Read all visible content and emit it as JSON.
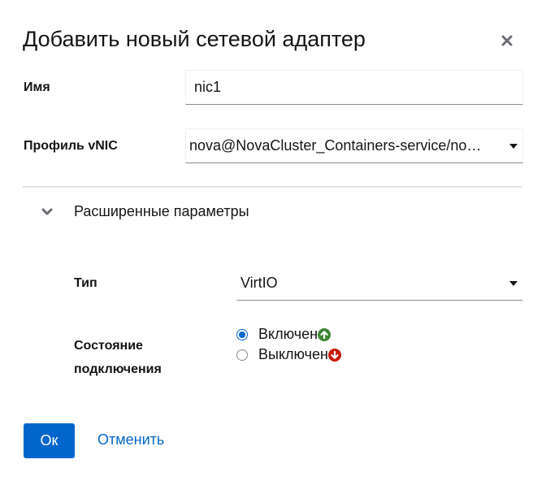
{
  "dialog": {
    "title": "Добавить новый сетевой адаптер",
    "close_icon": "close-icon"
  },
  "form": {
    "name": {
      "label": "Имя",
      "value": "nic1"
    },
    "vnic_profile": {
      "label": "Профиль vNIC",
      "selected": "nova@NovaCluster_Containers-service/no…"
    },
    "advanced": {
      "label": "Расширенные параметры",
      "expanded": true,
      "type": {
        "label": "Тип",
        "selected": "VirtIO"
      },
      "link_state": {
        "label_line1": "Состояние",
        "label_line2": "подключения",
        "options": [
          {
            "label": "Включен",
            "checked": true,
            "icon": "up-arrow-icon",
            "color": "#3e8635"
          },
          {
            "label": "Выключен",
            "checked": false,
            "icon": "down-arrow-icon",
            "color": "#c9190b"
          }
        ]
      }
    }
  },
  "footer": {
    "ok_label": "Ок",
    "cancel_label": "Отменить"
  },
  "colors": {
    "primary": "#0066cc",
    "text": "#151515",
    "divider": "#e4e4e4"
  }
}
